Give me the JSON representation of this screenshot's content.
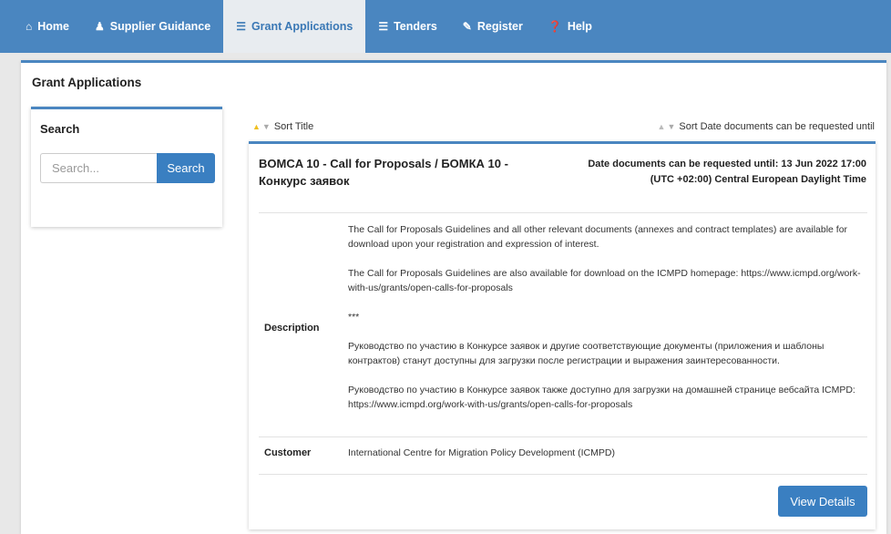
{
  "nav": {
    "items": [
      {
        "label": "Home",
        "icon": "home-icon",
        "glyph": "⌂"
      },
      {
        "label": "Supplier Guidance",
        "icon": "user-icon",
        "glyph": "♟"
      },
      {
        "label": "Grant Applications",
        "icon": "document-icon",
        "glyph": "☰"
      },
      {
        "label": "Tenders",
        "icon": "document-icon",
        "glyph": "☰"
      },
      {
        "label": "Register",
        "icon": "edit-icon",
        "glyph": "✎"
      },
      {
        "label": "Help",
        "icon": "help-icon",
        "glyph": "❓"
      }
    ],
    "active_index": 2
  },
  "page": {
    "title": "Grant Applications"
  },
  "search": {
    "title": "Search",
    "placeholder": "Search...",
    "button_label": "Search"
  },
  "sort": {
    "title_label": "Sort Title",
    "date_label": "Sort Date documents can be requested until"
  },
  "listing": {
    "title": "BOMCA 10 - Call for Proposals / БОМКА 10 - Конкурс заявок",
    "date_line1": "Date documents can be requested until: 13 Jun 2022 17:00",
    "date_line2": "(UTC +02:00) Central European Daylight Time",
    "description_label": "Description",
    "description_paragraphs": [
      "The Call for Proposals Guidelines and all other relevant documents (annexes and contract templates) are available for download upon your registration and expression of interest.",
      "The Call for Proposals Guidelines are also available for download on the ICMPD homepage: https://www.icmpd.org/work-with-us/grants/open-calls-for-proposals",
      "***",
      "Руководство по участию в Конкурсе заявок и другие соответствующие документы (приложения и шаблоны контрактов) станут доступны для загрузки после регистрации и выражения заинтересованности.",
      "Руководство по участию в Конкурсе заявок также доступно для загрузки на домашней странице вебсайта ICMPD: https://www.icmpd.org/work-with-us/grants/open-calls-for-proposals"
    ],
    "customer_label": "Customer",
    "customer_value": "International Centre for Migration Policy Development (ICMPD)",
    "view_button": "View Details"
  },
  "colors": {
    "brand": "#4a86c0",
    "button": "#3a7fc1",
    "sort_active": "#f0c020"
  }
}
